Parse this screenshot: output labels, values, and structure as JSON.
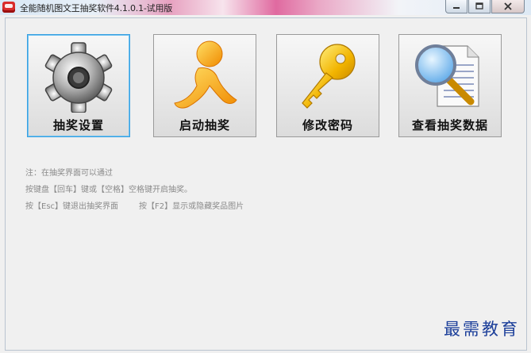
{
  "window": {
    "title": "全能随机图文王抽奖软件4.1.0.1-试用版",
    "controls": [
      "minimize",
      "maximize",
      "close"
    ]
  },
  "tiles": [
    {
      "label": "抽奖设置",
      "icon": "gear-icon",
      "selected": true
    },
    {
      "label": "启动抽奖",
      "icon": "running-man-icon",
      "selected": false
    },
    {
      "label": "修改密码",
      "icon": "key-icon",
      "selected": false
    },
    {
      "label": "查看抽奖数据",
      "icon": "magnifier-document-icon",
      "selected": false
    }
  ],
  "notes": {
    "line1": "注：在抽奖界面可以通过",
    "line2": "按键盘【回车】键或【空格】空格键开启抽奖。",
    "line3a": "按【Esc】键退出抽奖界面",
    "line3b": "按【F2】显示或隐藏奖品图片"
  },
  "watermark": "最需教育"
}
